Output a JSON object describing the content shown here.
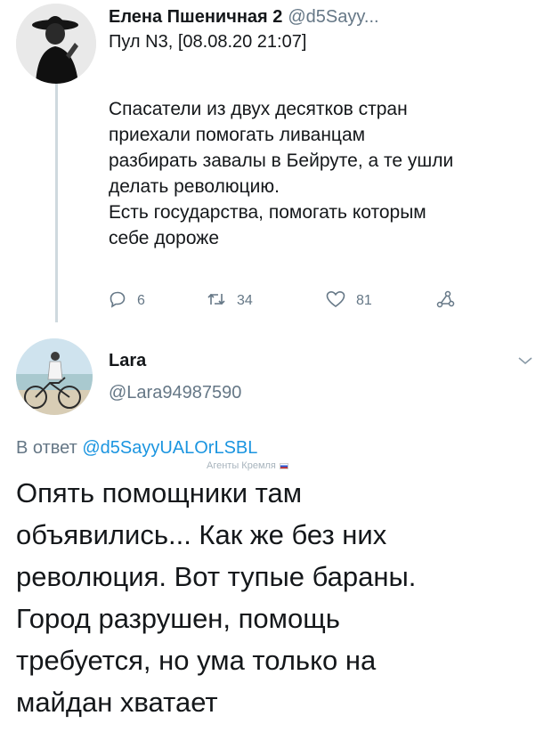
{
  "tweet1": {
    "display_name": "Елена Пшеничная 2",
    "handle": "@d5Sayy...",
    "subline": "Пул N3, [08.08.20 21:07]",
    "body_lines": [
      "Спасатели из двух десятков стран",
      "приехали помогать ливанцам",
      "разбирать завалы в Бейруте, а те ушли",
      "делать революцию.",
      "Есть государства, помогать которым",
      "себе дороже"
    ],
    "actions": {
      "replies": "6",
      "retweets": "34",
      "likes": "81"
    }
  },
  "tweet2": {
    "display_name": "Lara",
    "handle": "@Lara94987590",
    "replying_prefix": "В ответ",
    "replying_to": "@d5SayyUALOrLSBL",
    "badge_label": "Агенты Кремля",
    "body_lines": [
      "Опять помощники там",
      "объявились... Как же без них",
      "революция.  Вот тупые бараны.",
      "Город разрушен, помощь",
      "требуется, но ума только на",
      "майдан хватает"
    ]
  },
  "colors": {
    "text": "#14171a",
    "secondary": "#657786",
    "link": "#1b95e0",
    "thread_line": "#cfd9de"
  },
  "icons": [
    "reply-icon",
    "retweet-icon",
    "like-icon",
    "share-icon",
    "chevron-down-icon"
  ]
}
